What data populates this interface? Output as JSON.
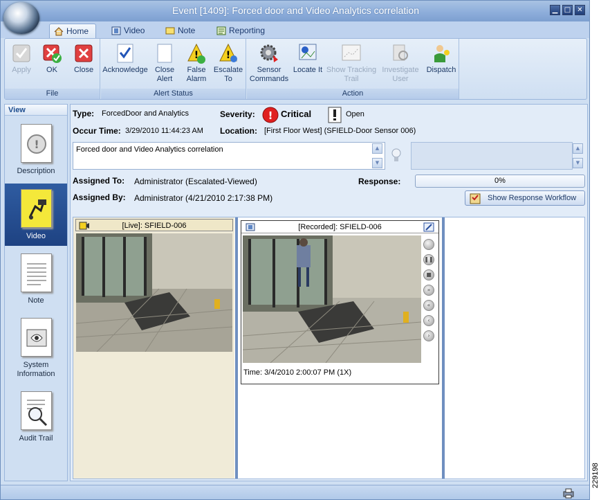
{
  "window": {
    "title": "Event [1409]: Forced door and Video Analytics correlation",
    "controls": [
      "minimize",
      "maximize",
      "close"
    ]
  },
  "tabs": [
    {
      "label": "Home",
      "icon": "home-icon",
      "active": true
    },
    {
      "label": "Video",
      "icon": "film-icon",
      "active": false
    },
    {
      "label": "Note",
      "icon": "note-icon",
      "active": false
    },
    {
      "label": "Reporting",
      "icon": "report-icon",
      "active": false
    }
  ],
  "ribbon": {
    "groups": [
      {
        "label": "File",
        "buttons": [
          {
            "label": "Apply",
            "icon": "check-icon",
            "enabled": false
          },
          {
            "label": "OK",
            "icon": "ok-icon",
            "enabled": true
          },
          {
            "label": "Close",
            "icon": "close-icon",
            "enabled": true
          }
        ]
      },
      {
        "label": "Alert Status",
        "buttons": [
          {
            "label": "Acknowledge",
            "icon": "acknowledge-icon",
            "enabled": true
          },
          {
            "label": "Close Alert",
            "icon": "close-alert-icon",
            "enabled": true
          },
          {
            "label": "False Alarm",
            "icon": "false-alarm-icon",
            "enabled": true
          },
          {
            "label": "Escalate To",
            "icon": "escalate-icon",
            "enabled": true
          }
        ]
      },
      {
        "label": "Action",
        "buttons": [
          {
            "label": "Sensor Commands",
            "icon": "gear-icon",
            "enabled": true
          },
          {
            "label": "Locate It",
            "icon": "locate-icon",
            "enabled": true
          },
          {
            "label": "Show Tracking Trail",
            "icon": "tracking-icon",
            "enabled": false
          },
          {
            "label": "Investigate User",
            "icon": "investigate-icon",
            "enabled": false
          },
          {
            "label": "Dispatch",
            "icon": "dispatch-icon",
            "enabled": true
          }
        ]
      }
    ]
  },
  "view_panel": {
    "title": "View",
    "items": [
      {
        "label": "Description",
        "icon": "description-icon",
        "selected": false
      },
      {
        "label": "Video",
        "icon": "video-icon",
        "selected": true
      },
      {
        "label": "Note",
        "icon": "note-page-icon",
        "selected": false
      },
      {
        "label": "System Information",
        "icon": "system-info-icon",
        "selected": false
      },
      {
        "label": "Audit Trail",
        "icon": "audit-trail-icon",
        "selected": false
      }
    ]
  },
  "event": {
    "type_label": "Type:",
    "type_value": "ForcedDoor and Analytics",
    "severity_label": "Severity:",
    "severity_value": "Critical",
    "status_value": "Open",
    "occur_label": "Occur Time:",
    "occur_value": "3/29/2010 11:44:23 AM",
    "location_label": "Location:",
    "location_value": "[First Floor West] (SFIELD-Door Sensor 006)",
    "description": "Forced door and Video Analytics correlation",
    "assigned_to_label": "Assigned To:",
    "assigned_to_value": "Administrator (Escalated-Viewed)",
    "assigned_by_label": "Assigned By:",
    "assigned_by_value": "Administrator (4/21/2010 2:17:38 PM)",
    "response_label": "Response:",
    "response_progress": "0%",
    "workflow_button": "Show Response Workflow"
  },
  "video": {
    "live_title": "[Live]: SFIELD-006",
    "recorded_title": "[Recorded]: SFIELD-006",
    "recorded_time": "Time: 3/4/2010 2:00:07 PM (1X)",
    "controls": [
      "record-icon",
      "pause-icon",
      "stop-icon",
      "fast-forward-icon",
      "rewind-icon",
      "step-back-icon",
      "step-forward-icon"
    ]
  },
  "figure_number": "229198",
  "colors": {
    "critical": "#e02020",
    "selected_view": "#2a5298",
    "titlebar": "#8eaedb"
  }
}
